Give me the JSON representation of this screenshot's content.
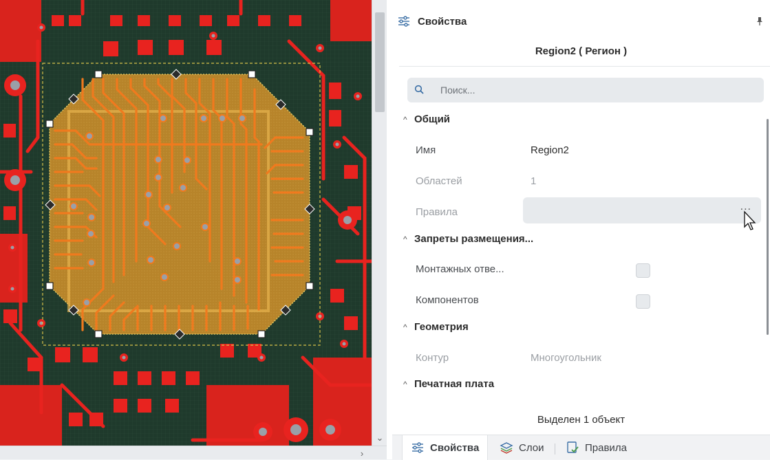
{
  "panel": {
    "title": "Свойства",
    "icon": "sliders-icon",
    "pin_icon": "pin-icon"
  },
  "object_title": "Region2 ( Регион )",
  "search": {
    "placeholder": "Поиск...",
    "icon": "search-icon"
  },
  "sections": {
    "general": {
      "title": "Общий",
      "name_label": "Имя",
      "name_value": "Region2",
      "areas_label": "Областей",
      "areas_value": "1",
      "rules_label": "Правила",
      "rules_button": "..."
    },
    "placement": {
      "title": "Запреты размещения...",
      "holes_label": "Монтажных отве...",
      "components_label": "Компонентов"
    },
    "geometry": {
      "title": "Геометрия",
      "contour_label": "Контур",
      "contour_value": "Многоугольник"
    },
    "board": {
      "title": "Печатная плата"
    }
  },
  "status": "Выделен 1 объект",
  "tabs": [
    {
      "label": "Свойства",
      "icon": "sliders-icon",
      "active": true
    },
    {
      "label": "Слои",
      "icon": "layers-icon",
      "active": false
    },
    {
      "label": "Правила",
      "icon": "rules-icon",
      "active": false
    }
  ],
  "colors": {
    "pcb_background": "#1f3a2c",
    "copper": "#e8231f",
    "region_fill": "#c9902a",
    "trace": "#f07a1e",
    "via": "#9aa0a8",
    "outline": "#d8c24a"
  }
}
